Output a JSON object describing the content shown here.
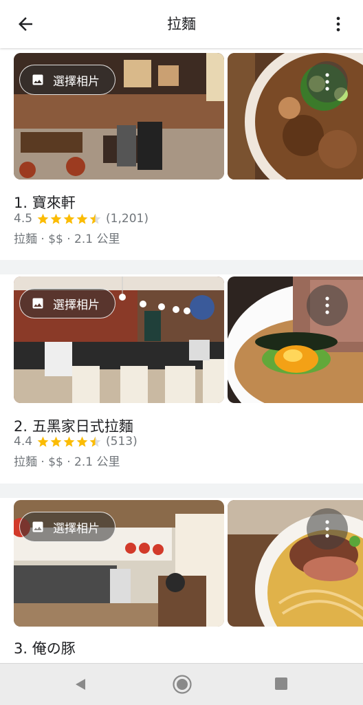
{
  "appbar": {
    "title": "拉麵",
    "back_icon": "arrow-left-icon",
    "more_icon": "more-vert-icon"
  },
  "photo_button_label": "選擇相片",
  "results": [
    {
      "name": "1. 寶來軒",
      "rating": "4.5",
      "stars": 4.5,
      "review_count": "(1,201)",
      "meta": "拉麵 · $$ · 2.1 公里"
    },
    {
      "name": "2. 五黑家日式拉麵",
      "rating": "4.4",
      "stars": 4.5,
      "review_count": "(513)",
      "meta": "拉麵 · $$ · 2.1 公里"
    },
    {
      "name": "3. 俺の豚"
    }
  ],
  "colors": {
    "star": "#fbbc04",
    "secondary_text": "#70757a",
    "divider": "#f1f3f4"
  }
}
